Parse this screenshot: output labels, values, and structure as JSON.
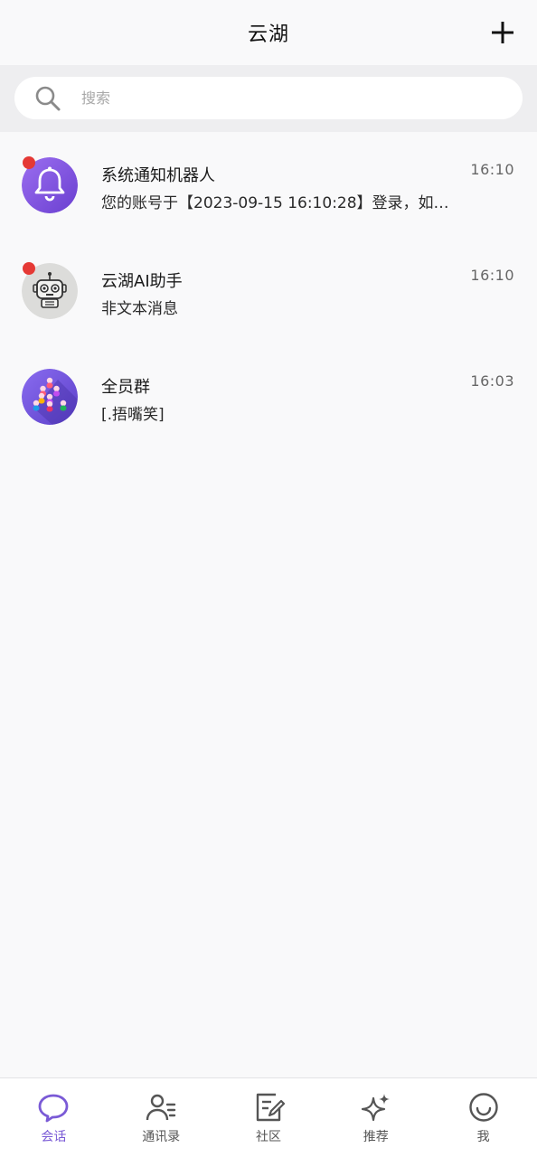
{
  "header": {
    "title": "云湖"
  },
  "search": {
    "placeholder": "搜索"
  },
  "conversations": [
    {
      "name": "系统通知机器人",
      "preview": "您的账号于【2023-09-15 16:10:28】登录，如…",
      "time": "16:10",
      "unread": true,
      "avatar": "bell-icon"
    },
    {
      "name": "云湖AI助手",
      "preview": "非文本消息",
      "time": "16:10",
      "unread": true,
      "avatar": "robot-icon"
    },
    {
      "name": "全员群",
      "preview": "[.捂嘴笑]",
      "time": "16:03",
      "unread": false,
      "avatar": "group-icon"
    }
  ],
  "nav": [
    {
      "label": "会话",
      "icon": "chat-bubble-icon",
      "active": true
    },
    {
      "label": "通讯录",
      "icon": "contacts-icon",
      "active": false
    },
    {
      "label": "社区",
      "icon": "edit-note-icon",
      "active": false
    },
    {
      "label": "推荐",
      "icon": "sparkle-icon",
      "active": false
    },
    {
      "label": "我",
      "icon": "smile-face-icon",
      "active": false
    }
  ],
  "colors": {
    "accent": "#7a5ad6",
    "unread": "#e53935",
    "background": "#f9f9fa"
  }
}
